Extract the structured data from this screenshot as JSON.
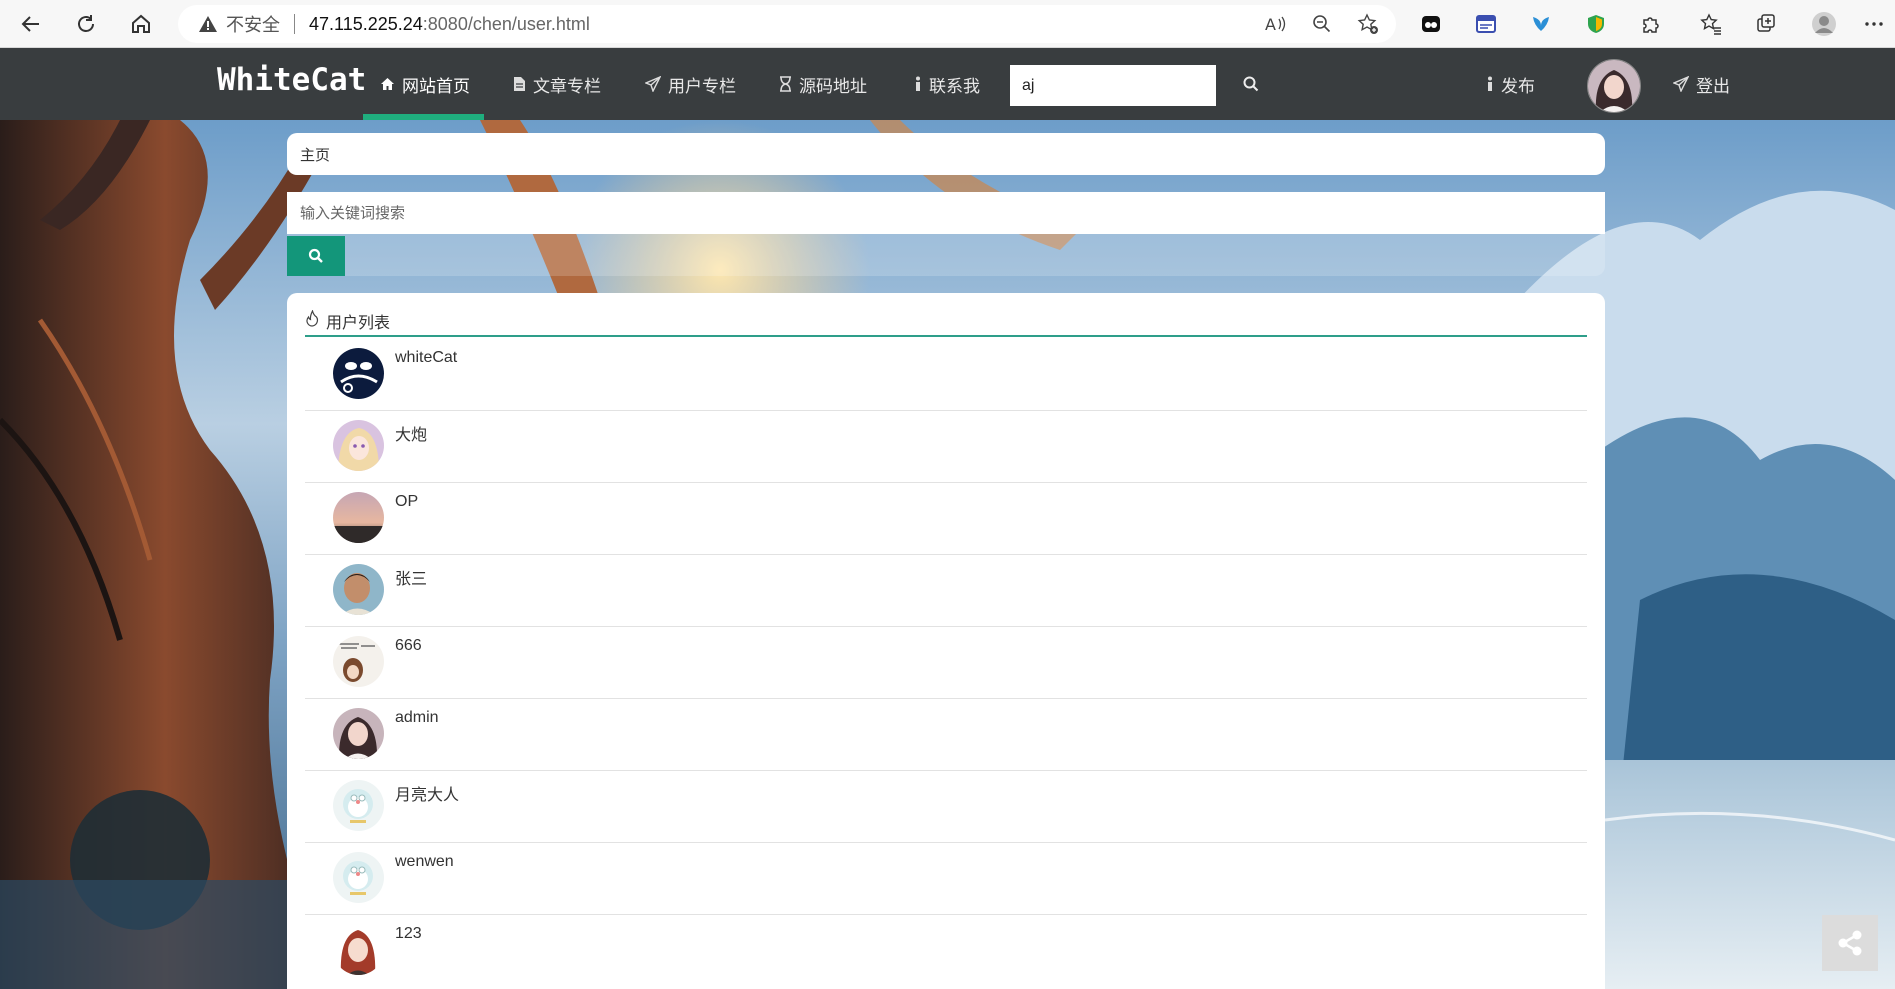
{
  "browser": {
    "insecure_label": "不安全",
    "url_host": "47.115.225.24",
    "url_path": ":8080/chen/user.html"
  },
  "nav": {
    "logo": "WhiteCat",
    "items": [
      {
        "label": "网站首页",
        "icon": "home-icon"
      },
      {
        "label": "文章专栏",
        "icon": "file-icon"
      },
      {
        "label": "用户专栏",
        "icon": "paper-plane-icon"
      },
      {
        "label": "源码地址",
        "icon": "hourglass-icon"
      },
      {
        "label": "联系我",
        "icon": "info-icon"
      }
    ],
    "search_value": "aj",
    "publish_label": "发布",
    "logout_label": "登出"
  },
  "breadcrumb": "主页",
  "keyword_search": {
    "placeholder": "输入关键词搜索"
  },
  "user_list": {
    "title": "用户列表",
    "users": [
      {
        "name": "whiteCat"
      },
      {
        "name": "大炮"
      },
      {
        "name": "OP"
      },
      {
        "name": "张三"
      },
      {
        "name": "666"
      },
      {
        "name": "admin"
      },
      {
        "name": "月亮大人"
      },
      {
        "name": "wenwen"
      },
      {
        "name": "123"
      }
    ]
  },
  "colors": {
    "nav_bg": "#393d3f",
    "accent_green": "#1fae7e",
    "search_btn": "#13967a"
  }
}
